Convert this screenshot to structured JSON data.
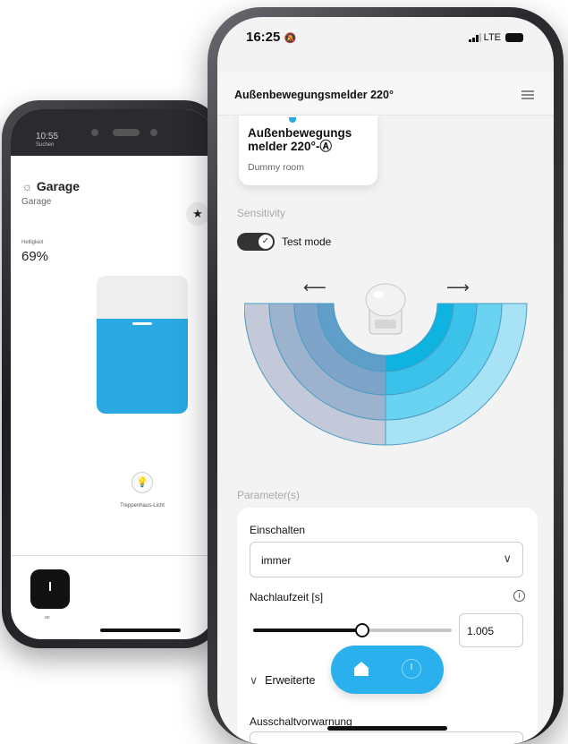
{
  "back_phone": {
    "status_time": "10:55",
    "status_sub": "Suchen",
    "room_title": "Garage",
    "room_subtitle": "Garage",
    "star_icon": "★",
    "brightness_label": "Helligkeit",
    "brightness_value": "69%",
    "brightness_level": 0.69,
    "light_name": "Treppenhaus-Licht",
    "switch_state": "an"
  },
  "front_phone": {
    "status_time": "16:25",
    "network": "LTE",
    "title": "Außenbewegungsmelder 220°",
    "device_card": {
      "name": "Außenbewegungs melder 220°-Ⓐ",
      "room": "Dummy room"
    },
    "sensitivity_label": "Sensitivity",
    "test_mode_label": "Test mode",
    "test_mode_on": true,
    "arrow_left": "⟵",
    "arrow_right": "⟶",
    "parameters_label": "Parameter(s)",
    "einschalten_label": "Einschalten",
    "einschalten_value": "immer",
    "nachlaufzeit_label": "Nachlaufzeit [s]",
    "nachlaufzeit_value": "1.005",
    "nachlaufzeit_fraction": 0.55,
    "erweiterte_label": "Erweiterte",
    "ausschalt_label": "Ausschaltvorwarnung"
  },
  "colors": {
    "accent_blue": "#2ab0ec",
    "zone_grey": "#bcc6d8",
    "zone_blue": "#56cdee"
  },
  "icons": [
    "star-icon",
    "bulb-icon",
    "menu-icon",
    "check-icon",
    "chevron-down-icon",
    "info-icon",
    "home-icon",
    "clock-icon"
  ]
}
